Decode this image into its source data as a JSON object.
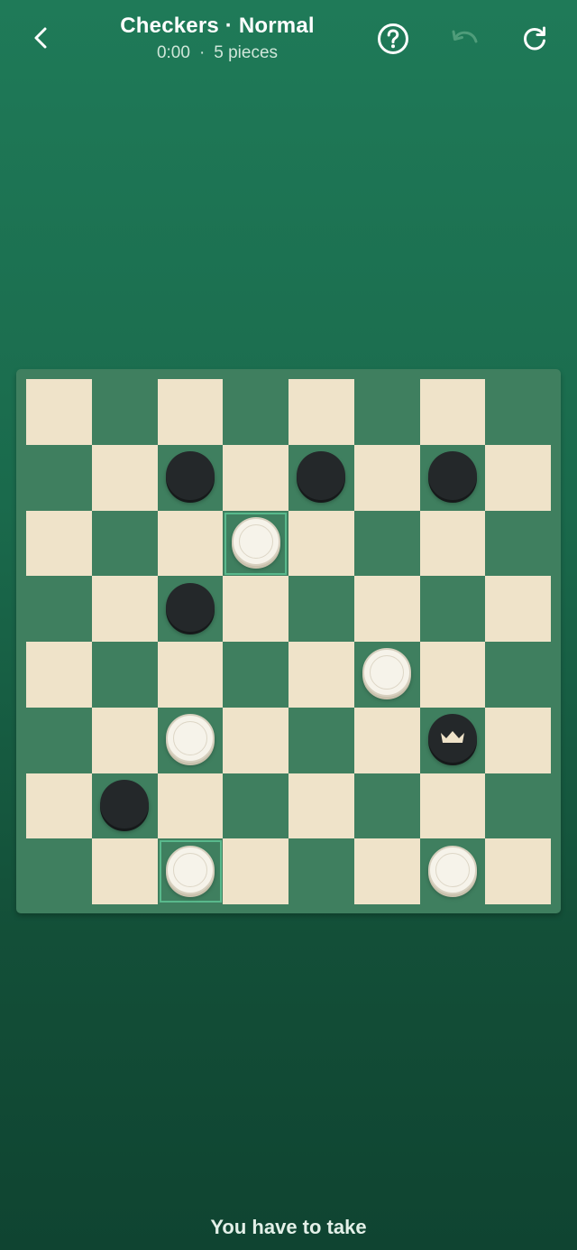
{
  "header": {
    "title": "Checkers · Normal",
    "timer": "0:00",
    "separator": "·",
    "pieces": "5 pieces",
    "back_icon": "chevron-left-icon",
    "help_icon": "question-circle-icon",
    "undo_icon": "undo-icon",
    "restart_icon": "restart-icon"
  },
  "board": {
    "size": 8,
    "light_color": "#efe3c9",
    "dark_color": "#3f7f5f",
    "highlight_color": "#59b98c",
    "highlighted_squares": [
      {
        "row": 2,
        "col": 3
      },
      {
        "row": 7,
        "col": 2
      }
    ],
    "pieces": [
      {
        "row": 1,
        "col": 2,
        "color": "black",
        "king": false
      },
      {
        "row": 1,
        "col": 4,
        "color": "black",
        "king": false
      },
      {
        "row": 1,
        "col": 6,
        "color": "black",
        "king": false
      },
      {
        "row": 2,
        "col": 3,
        "color": "white",
        "king": false
      },
      {
        "row": 3,
        "col": 2,
        "color": "black",
        "king": false
      },
      {
        "row": 4,
        "col": 5,
        "color": "white",
        "king": false
      },
      {
        "row": 5,
        "col": 2,
        "color": "white",
        "king": false
      },
      {
        "row": 5,
        "col": 6,
        "color": "black",
        "king": true
      },
      {
        "row": 6,
        "col": 1,
        "color": "black",
        "king": false
      },
      {
        "row": 7,
        "col": 2,
        "color": "white",
        "king": false
      },
      {
        "row": 7,
        "col": 6,
        "color": "white",
        "king": false
      }
    ]
  },
  "status": {
    "message": "You have to take"
  },
  "colors": {
    "background_top": "#1f7a58",
    "background_bottom": "#0f4431",
    "black_piece": "#24282a",
    "white_piece": "#f6f3ea"
  }
}
